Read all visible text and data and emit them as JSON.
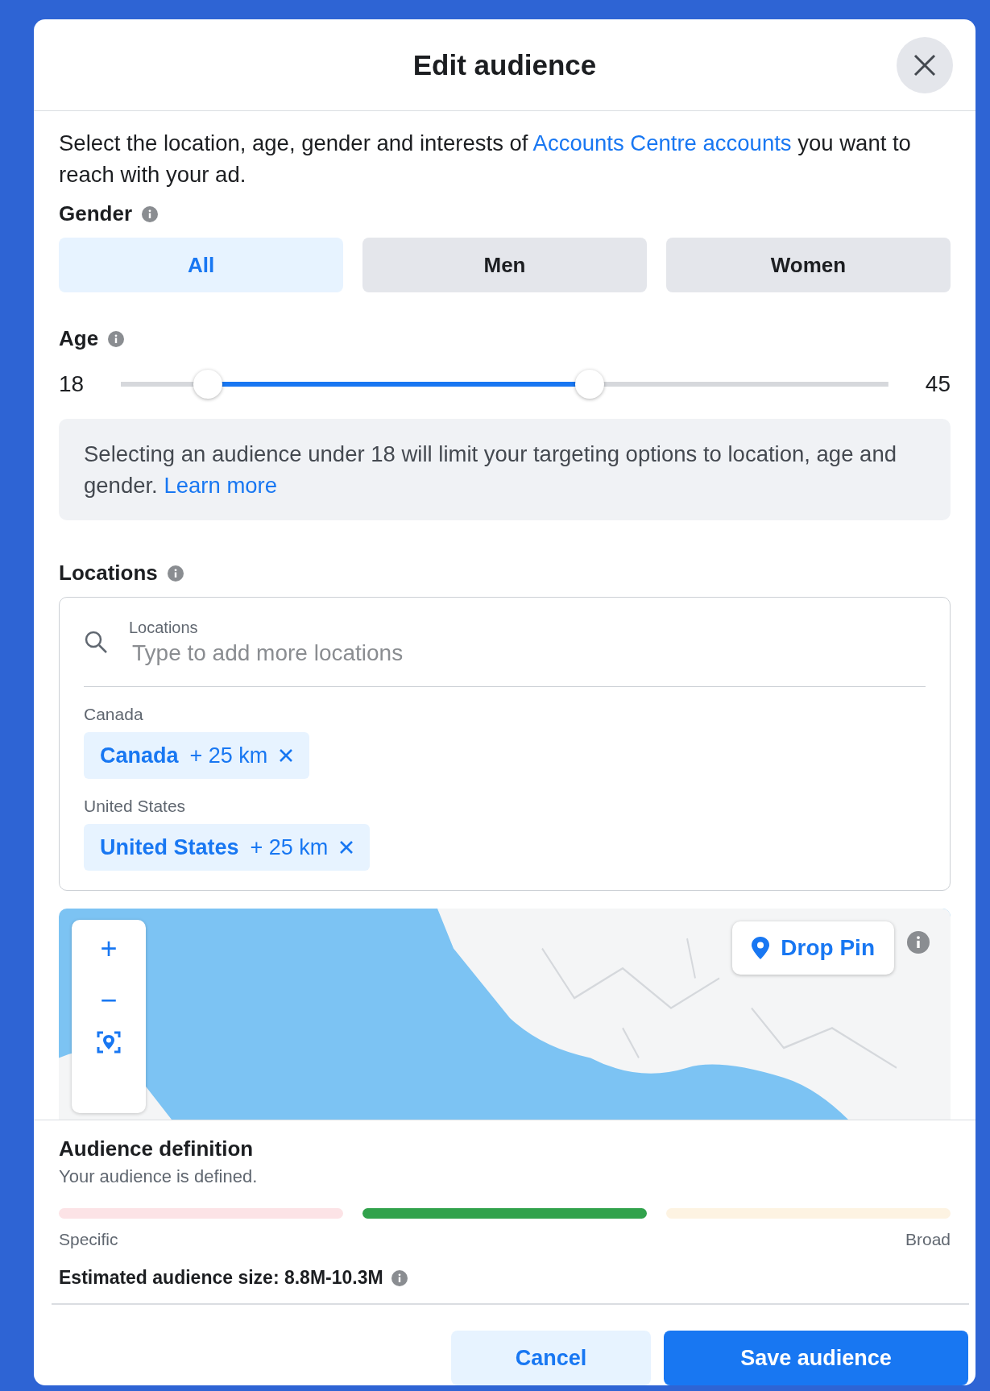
{
  "dialog": {
    "title": "Edit audience"
  },
  "intro": {
    "before": "Select the location, age, gender and interests of ",
    "link": "Accounts Centre accounts",
    "after": " you want to reach with your ad."
  },
  "gender": {
    "label": "Gender",
    "options": [
      {
        "label": "All",
        "selected": true
      },
      {
        "label": "Men",
        "selected": false
      },
      {
        "label": "Women",
        "selected": false
      }
    ]
  },
  "age": {
    "label": "Age",
    "min_label": "18",
    "max_label": "45",
    "thumbs": [
      {
        "level": 0.113
      },
      {
        "level": 0.611
      }
    ]
  },
  "notice": {
    "text": "Selecting an audience under 18 will limit your targeting options to location, age and gender. ",
    "link": "Learn more"
  },
  "locations": {
    "label": "Locations",
    "search": {
      "label": "Locations",
      "placeholder": "Type to add more locations"
    },
    "groups": [
      {
        "heading": "Canada",
        "chip": {
          "name": "Canada",
          "radius": "+ 25 km"
        }
      },
      {
        "heading": "United States",
        "chip": {
          "name": "United States",
          "radius": "+ 25 km"
        }
      }
    ]
  },
  "map": {
    "kind": "picture",
    "zoom_in": "+",
    "zoom_out": "−",
    "drop_pin": "Drop Pin"
  },
  "audience_definition": {
    "title": "Audience definition",
    "status": "Your audience is defined.",
    "segments": [
      {
        "color": "#fce3e6"
      },
      {
        "color": "#31a24c"
      },
      {
        "color": "#fdf3e2"
      }
    ],
    "low_label": "Specific",
    "high_label": "Broad",
    "estimate": "Estimated audience size: 8.8M-10.3M"
  },
  "buttons": [
    {
      "label": "Cancel",
      "kind": "secondary"
    },
    {
      "label": "Save audience",
      "kind": "primary"
    }
  ]
}
